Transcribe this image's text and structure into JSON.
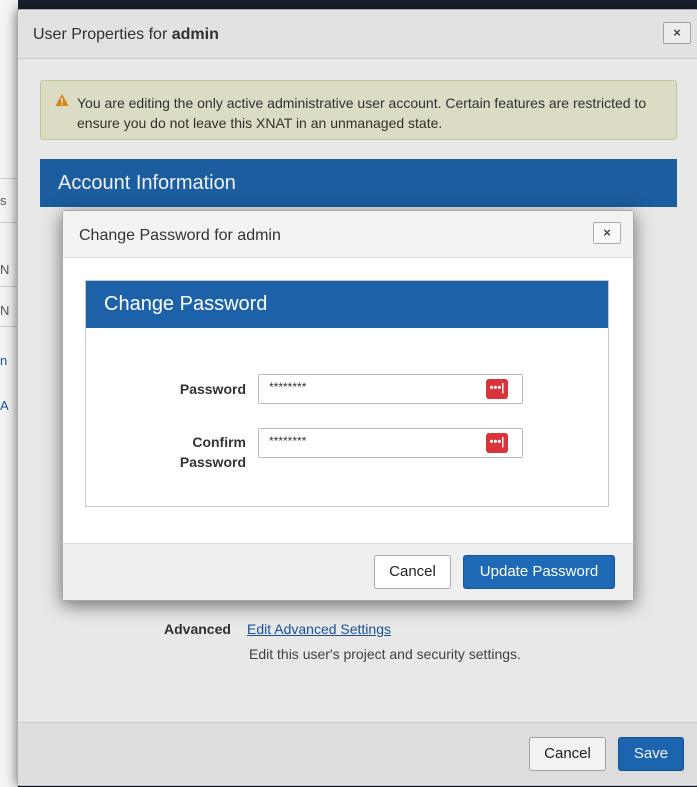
{
  "background": {
    "letters": [
      "s",
      "N",
      "N",
      "n",
      "A"
    ]
  },
  "user_properties_dialog": {
    "title_prefix": "User Properties for ",
    "title_user": "admin",
    "close_label": "×",
    "warning_text": "You are editing the only active administrative user account. Certain features are restricted to ensure you do not leave this XNAT in an unmanaged state.",
    "account_section_title": "Account Information",
    "advanced_label": "Advanced",
    "advanced_link": "Edit Advanced Settings",
    "advanced_desc": "Edit this user's project and security settings.",
    "cancel_label": "Cancel",
    "save_label": "Save"
  },
  "change_password_dialog": {
    "title": "Change Password for admin",
    "close_label": "×",
    "panel_title": "Change Password",
    "password_label": "Password",
    "password_value": "********",
    "confirm_label_line1": "Confirm",
    "confirm_label_line2": "Password",
    "confirm_value": "********",
    "password_manager_icon": "•••|",
    "cancel_label": "Cancel",
    "update_label": "Update Password"
  },
  "colors": {
    "primary_blue": "#1d62a8",
    "warning_bg": "#e8e8cf",
    "warning_icon": "#e08a1e",
    "pw_manager_red": "#d8343a"
  }
}
